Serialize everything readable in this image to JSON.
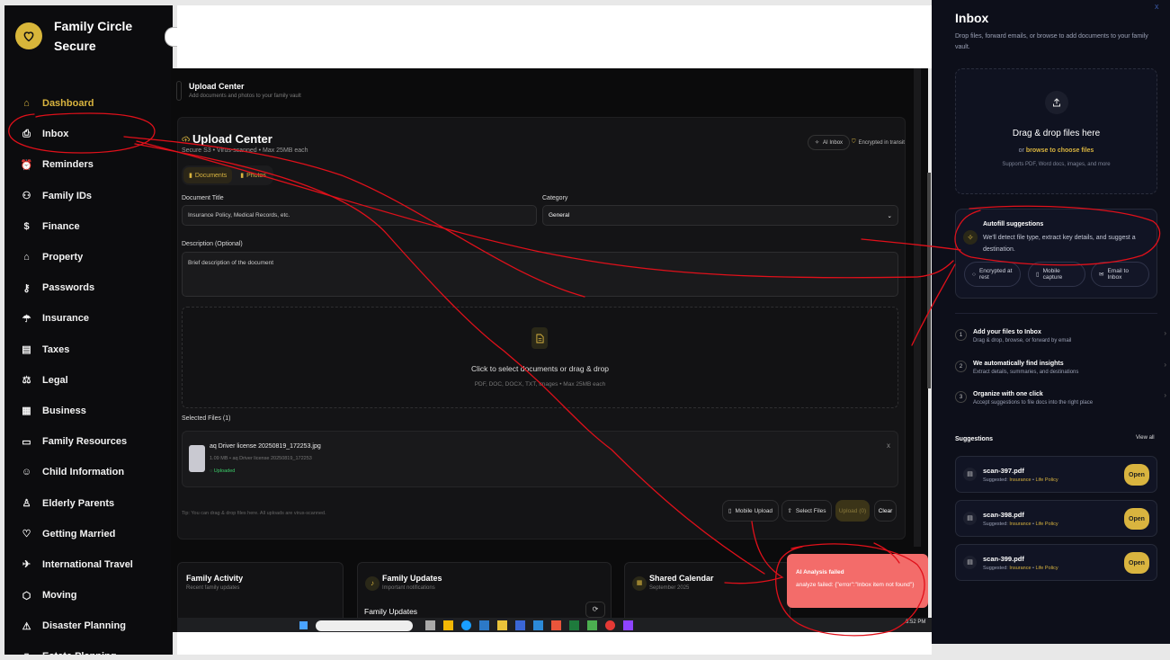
{
  "sidebar": {
    "brand": "Family Circle Secure",
    "items": [
      {
        "label": "Dashboard",
        "icon": "home-icon",
        "active": true
      },
      {
        "label": "Inbox",
        "icon": "inbox-icon"
      },
      {
        "label": "Reminders",
        "icon": "alarm-icon"
      },
      {
        "label": "Family IDs",
        "icon": "users-icon"
      },
      {
        "label": "Finance",
        "icon": "dollar-icon"
      },
      {
        "label": "Property",
        "icon": "house-icon"
      },
      {
        "label": "Passwords",
        "icon": "key-icon"
      },
      {
        "label": "Insurance",
        "icon": "umbrella-icon"
      },
      {
        "label": "Taxes",
        "icon": "receipt-icon"
      },
      {
        "label": "Legal",
        "icon": "scale-icon"
      },
      {
        "label": "Business",
        "icon": "building-icon"
      },
      {
        "label": "Family Resources",
        "icon": "book-icon"
      },
      {
        "label": "Child Information",
        "icon": "smile-icon"
      },
      {
        "label": "Elderly Parents",
        "icon": "person-icon"
      },
      {
        "label": "Getting Married",
        "icon": "heart-icon"
      },
      {
        "label": "International Travel",
        "icon": "plane-icon"
      },
      {
        "label": "Moving",
        "icon": "box-icon"
      },
      {
        "label": "Disaster Planning",
        "icon": "alert-icon"
      },
      {
        "label": "Estate Planning",
        "icon": "file-icon"
      }
    ]
  },
  "main": {
    "header_title": "Upload Center",
    "header_sub": "Add documents and photos to your family vault",
    "card_title": "Upload Center",
    "card_sub": "Secure S3 • Virus-scanned • Max 25MB each",
    "ai_inbox": "AI Inbox",
    "encrypted": "Encrypted in transit",
    "tabs": [
      "Documents",
      "Photos"
    ],
    "doc_title_label": "Document Title",
    "doc_title_placeholder": "Insurance Policy, Medical Records, etc.",
    "category_label": "Category",
    "category_value": "General",
    "desc_label": "Description (Optional)",
    "desc_placeholder": "Brief description of the document",
    "drop_text": "Click to select documents or drag & drop",
    "drop_types": "PDF, DOC, DOCX, TXT, Images • Max 25MB each",
    "selected_label": "Selected Files (1)",
    "file_name": "aq Driver license 20250819_172253.jpg",
    "file_meta": "1.09 MB • aq Driver license 20250819_172253",
    "file_status": "Uploaded",
    "tip": "Tip: You can drag & drop files here. All uploads are virus-scanned.",
    "buttons": {
      "mobile": "Mobile Upload",
      "select": "Select Files",
      "upload": "Upload (0)",
      "clear": "Clear"
    },
    "bottom_cards": [
      {
        "title": "Family Activity",
        "sub": "Recent family updates"
      },
      {
        "title": "Family Updates",
        "sub": "Important notifications",
        "inner": "Family Updates"
      },
      {
        "title": "Shared Calendar",
        "sub": "September 2025"
      }
    ]
  },
  "taskbar": {
    "time": "6:52 PM"
  },
  "toast": {
    "title": "AI Analysis failed",
    "message": "analyze failed: {\"error\":\"Inbox item not found\"}"
  },
  "inbox": {
    "title": "Inbox",
    "subtitle": "Drop files, forward emails, or browse to add documents to your family vault.",
    "drop_title": "Drag & drop files here",
    "drop_or": "or",
    "drop_link": "browse to choose files",
    "drop_support": "Supports PDF, Word docs, images, and more",
    "autofill_title": "Autofill suggestions",
    "autofill_desc": "We'll detect file type, extract key details, and suggest a destination.",
    "pills": [
      "Encrypted at rest",
      "Mobile capture",
      "Email to Inbox"
    ],
    "steps": [
      {
        "num": "1",
        "title": "Add your files to Inbox",
        "desc": "Drag & drop, browse, or forward by email"
      },
      {
        "num": "2",
        "title": "We automatically find insights",
        "desc": "Extract details, summaries, and destinations"
      },
      {
        "num": "3",
        "title": "Organize with one click",
        "desc": "Accept suggestions to file docs into the right place"
      }
    ],
    "suggestions_label": "Suggestions",
    "view_all": "View all",
    "suggestions": [
      {
        "name": "scan-397.pdf",
        "prefix": "Suggested:",
        "cat": "Insurance",
        "sub": "Life Policy",
        "open": "Open"
      },
      {
        "name": "scan-398.pdf",
        "prefix": "Suggested:",
        "cat": "Insurance",
        "sub": "Life Policy",
        "open": "Open"
      },
      {
        "name": "scan-399.pdf",
        "prefix": "Suggested:",
        "cat": "Insurance",
        "sub": "Life Policy",
        "open": "Open"
      }
    ]
  },
  "colors": {
    "accent": "#d9b43f",
    "annotation": "#e0101a",
    "toast": "#f36c6a"
  }
}
